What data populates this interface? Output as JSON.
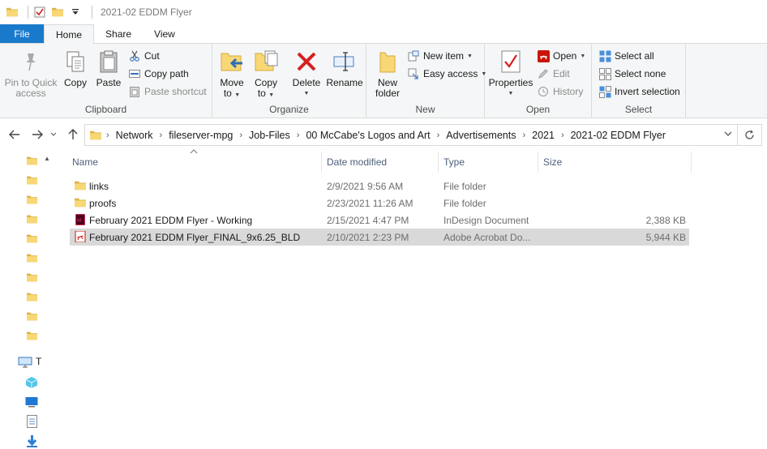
{
  "window": {
    "title": "2021-02 EDDM Flyer"
  },
  "tabs": [
    {
      "label": "File"
    },
    {
      "label": "Home"
    },
    {
      "label": "Share"
    },
    {
      "label": "View"
    }
  ],
  "ribbon": {
    "clipboard": {
      "label": "Clipboard",
      "pin": "Pin to Quick access",
      "pin_l1": "Pin to Quick",
      "pin_l2": "access",
      "copy": "Copy",
      "paste": "Paste",
      "cut": "Cut",
      "copy_path": "Copy path",
      "paste_shortcut": "Paste shortcut"
    },
    "organize": {
      "label": "Organize",
      "move_l1": "Move",
      "move_l2": "to",
      "copy_l1": "Copy",
      "copy_l2": "to",
      "delete": "Delete",
      "rename": "Rename"
    },
    "new": {
      "label": "New",
      "new_folder_l1": "New",
      "new_folder_l2": "folder",
      "new_item": "New item",
      "easy_access": "Easy access"
    },
    "open": {
      "label": "Open",
      "properties": "Properties",
      "open": "Open",
      "edit": "Edit",
      "history": "History"
    },
    "select": {
      "label": "Select",
      "select_all": "Select all",
      "select_none": "Select none",
      "invert": "Invert selection"
    }
  },
  "breadcrumbs": [
    "Network",
    "fileserver-mpg",
    "Job-Files",
    "00 McCabe's Logos and Art",
    "Advertisements",
    "2021",
    "2021-02 EDDM Flyer"
  ],
  "navpane": {
    "visible_label": "T"
  },
  "columns": {
    "name": "Name",
    "date": "Date modified",
    "type": "Type",
    "size": "Size"
  },
  "files": [
    {
      "name": "links",
      "date": "2/9/2021 9:56 AM",
      "type": "File folder",
      "size": "",
      "icon": "folder-icon"
    },
    {
      "name": "proofs",
      "date": "2/23/2021 11:26 AM",
      "type": "File folder",
      "size": "",
      "icon": "folder-icon"
    },
    {
      "name": "February 2021 EDDM Flyer - Working",
      "date": "2/15/2021 4:47 PM",
      "type": "InDesign Document",
      "size": "2,388 KB",
      "icon": "indesign-icon"
    },
    {
      "name": "February 2021 EDDM Flyer_FINAL_9x6.25_BLD",
      "date": "2/10/2021 2:23 PM",
      "type": "Adobe Acrobat Do...",
      "size": "5,944 KB",
      "icon": "pdf-icon"
    }
  ],
  "colors": {
    "file_tab": "#1979ca",
    "folder": "#f8d775",
    "selection": "#d9d9d9",
    "delete_red": "#d42020",
    "indesign": "#49021f",
    "pdf_red": "#c8160c"
  }
}
